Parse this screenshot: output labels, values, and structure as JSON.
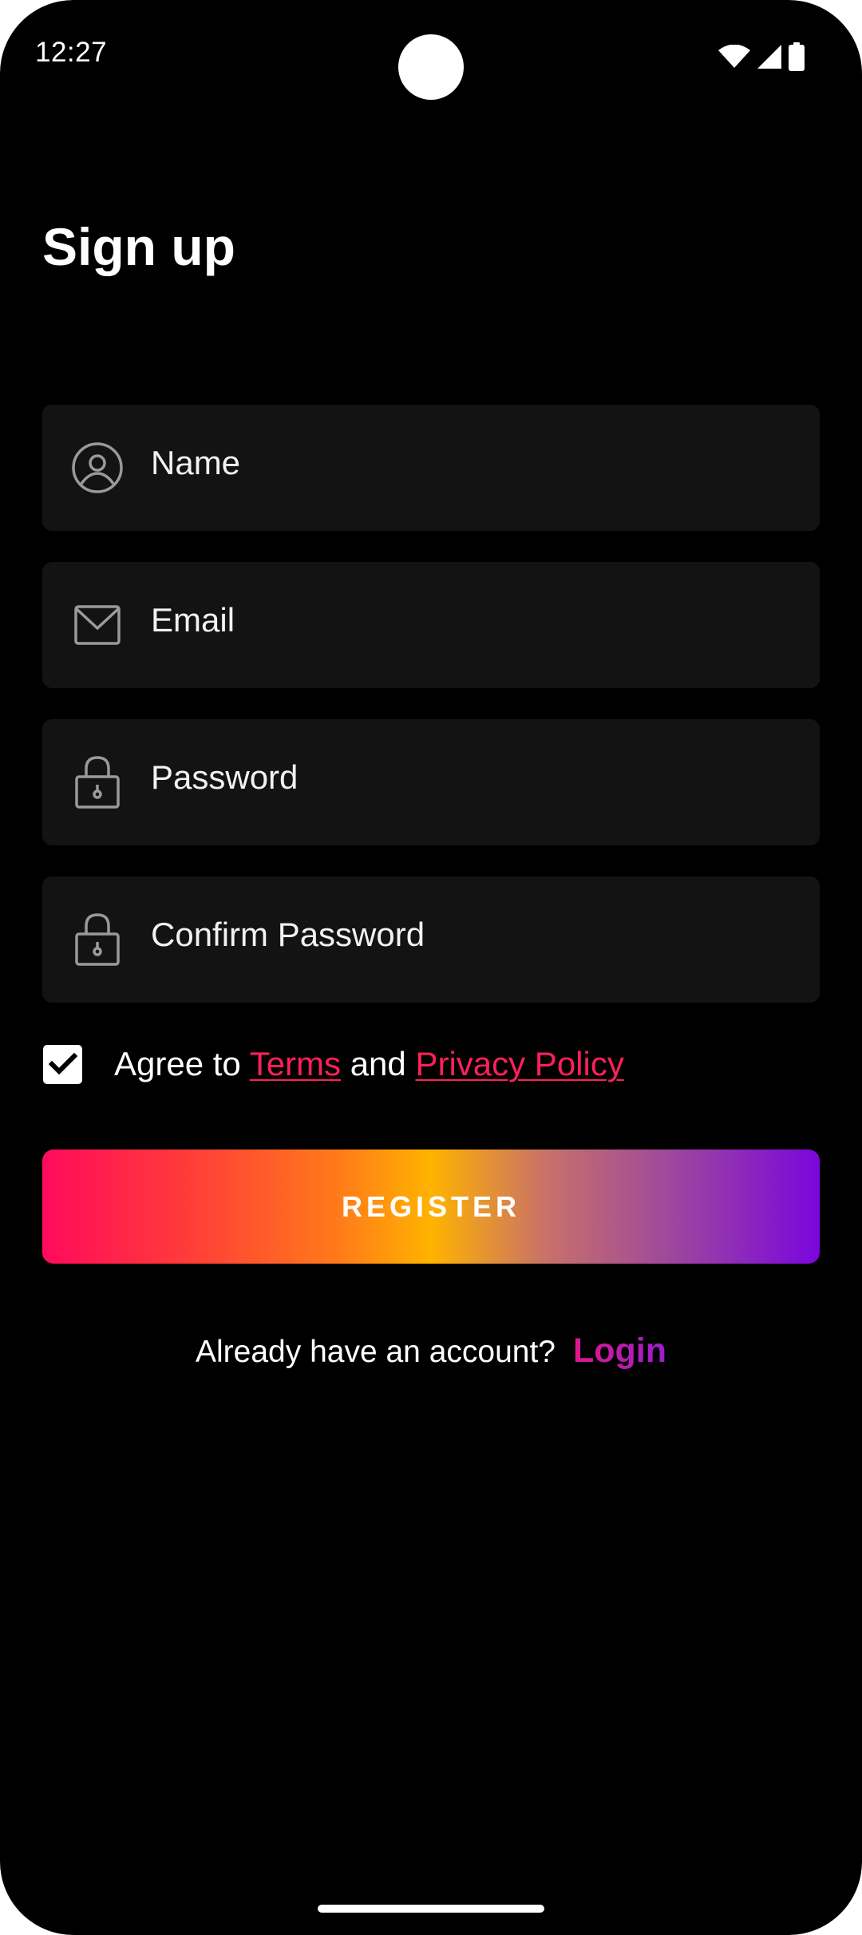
{
  "status_bar": {
    "time": "12:27",
    "icons": [
      "wifi-icon",
      "cellular-signal-icon",
      "battery-icon"
    ]
  },
  "page": {
    "title": "Sign up"
  },
  "form": {
    "name_placeholder": "Name",
    "email_placeholder": "Email",
    "password_placeholder": "Password",
    "confirm_password_placeholder": "Confirm Password",
    "agree": {
      "checked": true,
      "prefix": "Agree to ",
      "terms_label": "Terms",
      "middle": " and ",
      "privacy_label": "Privacy Policy"
    },
    "register_label": "REGISTER"
  },
  "footer": {
    "prompt": "Already have an account?",
    "login_label": "Login"
  },
  "colors": {
    "background": "#000000",
    "field_background": "#131313",
    "link": "#ff1f5a",
    "gradient_start": "#ff0a5c",
    "gradient_mid": "#ffb300",
    "gradient_end": "#7a06dd"
  }
}
